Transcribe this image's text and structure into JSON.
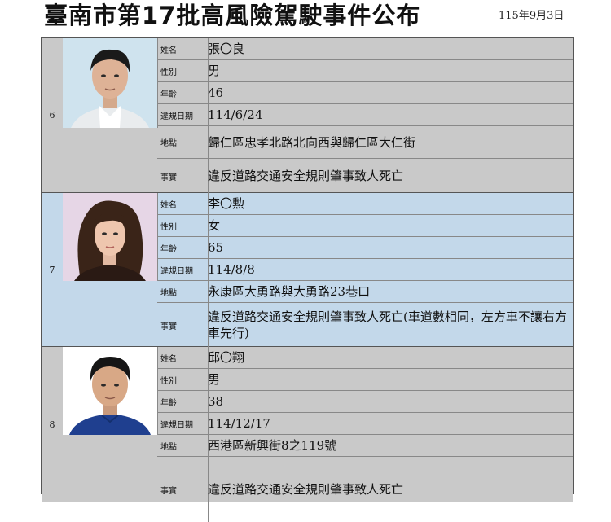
{
  "header": {
    "title": "臺南市第17批高風險駕駛事件公布",
    "date": "115年9月3日"
  },
  "labels": {
    "name": "姓名",
    "gender": "性別",
    "age": "年齡",
    "date": "違規日期",
    "location": "地點",
    "facts": "事實"
  },
  "records": [
    {
      "number": "6",
      "name": "張〇良",
      "gender": "男",
      "age": "46",
      "date": "114/6/24",
      "location": "歸仁區忠孝北路北向西與歸仁區大仁街",
      "facts": "違反道路交通安全規則肇事致人死亡",
      "row_color": "#c9c9c9"
    },
    {
      "number": "7",
      "name": "李〇勲",
      "gender": "女",
      "age": "65",
      "date": "114/8/8",
      "location": "永康區大勇路與大勇路23巷口",
      "facts": "違反道路交通安全規則肇事致人死亡(車道數相同，左方車不讓右方車先行)",
      "row_color": "#c3d8ea"
    },
    {
      "number": "8",
      "name": "邱〇翔",
      "gender": "男",
      "age": "38",
      "date": "114/12/17",
      "location": "西港區新興街8之119號",
      "facts": "違反道路交通安全規則肇事致人死亡",
      "row_color": "#c9c9c9"
    }
  ]
}
